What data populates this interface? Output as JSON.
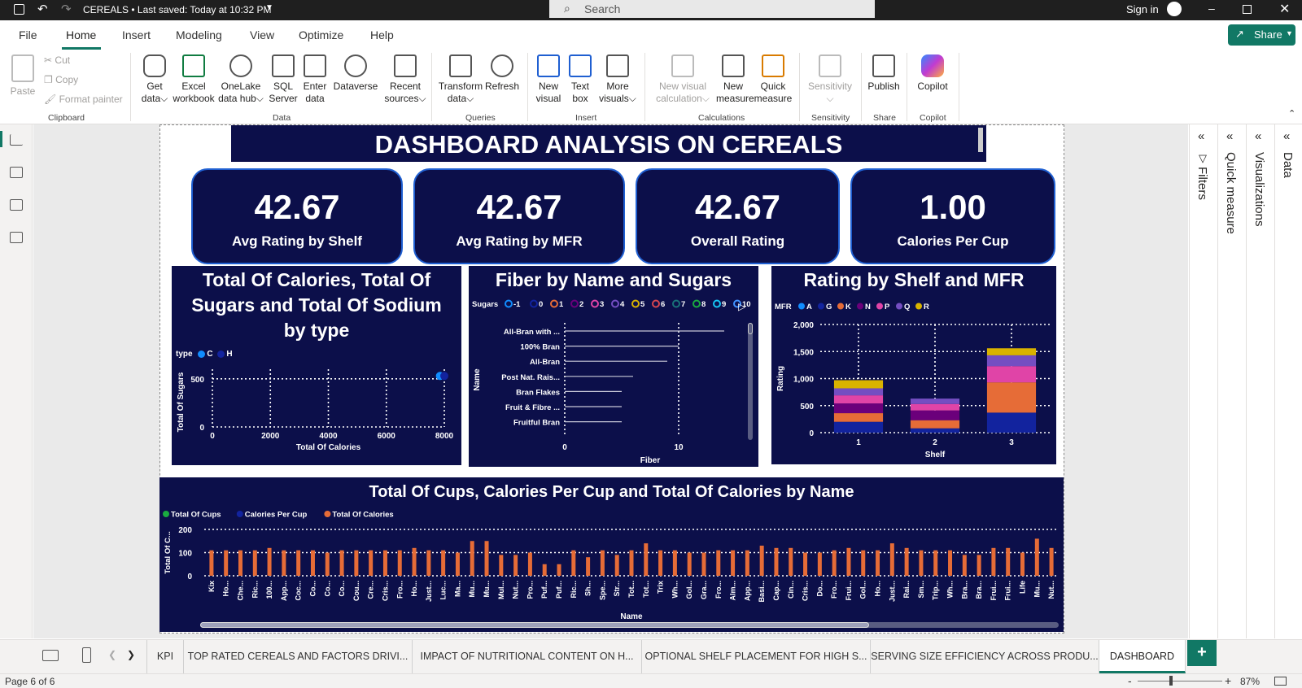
{
  "titlebar": {
    "file_title": "CEREALS",
    "saved_status": "Last saved: Today at 10:32 PM",
    "search_placeholder": "Search",
    "sign_in": "Sign in"
  },
  "menu": {
    "items": [
      "File",
      "Home",
      "Insert",
      "Modeling",
      "View",
      "Optimize",
      "Help"
    ],
    "active": "Home",
    "share": "Share"
  },
  "ribbon": {
    "clipboard": {
      "paste": "Paste",
      "cut": "Cut",
      "copy": "Copy",
      "format_painter": "Format painter",
      "group": "Clipboard"
    },
    "data": {
      "get_data": [
        "Get",
        "data"
      ],
      "excel": [
        "Excel",
        "workbook"
      ],
      "onelake": [
        "OneLake",
        "data hub"
      ],
      "sql": [
        "SQL",
        "Server"
      ],
      "enter": [
        "Enter",
        "data"
      ],
      "dataverse": "Dataverse",
      "recent": [
        "Recent",
        "sources"
      ],
      "group": "Data"
    },
    "queries": {
      "transform": [
        "Transform",
        "data"
      ],
      "refresh": "Refresh",
      "group": "Queries"
    },
    "insert": {
      "new_visual": [
        "New",
        "visual"
      ],
      "text_box": [
        "Text",
        "box"
      ],
      "more_visuals": [
        "More",
        "visuals"
      ],
      "group": "Insert"
    },
    "calculations": {
      "new_visual_calc": [
        "New visual",
        "calculation"
      ],
      "new_measure": [
        "New",
        "measure"
      ],
      "quick_measure": [
        "Quick",
        "measure"
      ],
      "group": "Calculations"
    },
    "sensitivity": {
      "label": "Sensitivity",
      "group": "Sensitivity"
    },
    "share": {
      "publish": "Publish",
      "group": "Share"
    },
    "copilot": {
      "label": "Copilot",
      "group": "Copilot"
    }
  },
  "dashboard": {
    "title": "DASHBOARD ANALYSIS ON CEREALS",
    "kpis": [
      {
        "value": "42.67",
        "label": "Avg Rating by Shelf"
      },
      {
        "value": "42.67",
        "label": "Avg Rating by MFR"
      },
      {
        "value": "42.67",
        "label": "Overall Rating"
      },
      {
        "value": "1.00",
        "label": "Calories Per Cup"
      }
    ]
  },
  "chart_data": [
    {
      "type": "scatter",
      "title": "Total Of Calories, Total Of Sugars and Total Of Sodium by type",
      "legend_title": "type",
      "legend": [
        {
          "name": "C",
          "color": "#118dff"
        },
        {
          "name": "H",
          "color": "#12239e"
        }
      ],
      "xlabel": "Total Of Calories",
      "ylabel": "Total Of Sugars",
      "xlim": [
        0,
        8000
      ],
      "ylim": [
        0,
        600
      ],
      "xticks": [
        "0",
        "2000",
        "4000",
        "6000",
        "8000"
      ],
      "yticks": [
        "0",
        "500"
      ],
      "points": [
        {
          "series": "C",
          "x": 7850,
          "y": 530
        },
        {
          "series": "H",
          "x": 8000,
          "y": 530
        }
      ]
    },
    {
      "type": "bar",
      "orientation": "horizontal",
      "title": "Fiber by Name and Sugars",
      "legend_title": "Sugars",
      "legend": [
        "-1",
        "0",
        "1",
        "2",
        "3",
        "4",
        "5",
        "6",
        "7",
        "8",
        "9",
        "10"
      ],
      "legend_colors": [
        "#118dff",
        "#12239e",
        "#e66c37",
        "#6b007b",
        "#e044a7",
        "#744ec2",
        "#d9b300",
        "#d64550",
        "#197278",
        "#1aab40",
        "#15c6f4",
        "#4092ff"
      ],
      "categories": [
        "All-Bran with ...",
        "100% Bran",
        "All-Bran",
        "Post Nat. Rais...",
        "Bran Flakes",
        "Fruit & Fibre ...",
        "Fruitful Bran"
      ],
      "values": [
        14,
        10,
        9,
        6,
        5,
        5,
        5
      ],
      "xlabel": "Fiber",
      "ylabel": "Name",
      "xlim": [
        0,
        15
      ],
      "xticks": [
        "0",
        "10"
      ]
    },
    {
      "type": "bar",
      "stacked": true,
      "title": "Rating by Shelf and MFR",
      "legend_title": "MFR",
      "categories": [
        "1",
        "2",
        "3"
      ],
      "series": [
        {
          "name": "A",
          "color": "#118dff",
          "values": [
            0,
            0,
            0
          ]
        },
        {
          "name": "G",
          "color": "#12239e",
          "values": [
            200,
            80,
            370
          ]
        },
        {
          "name": "K",
          "color": "#e66c37",
          "values": [
            160,
            150,
            560
          ]
        },
        {
          "name": "N",
          "color": "#6b007b",
          "values": [
            180,
            180,
            0
          ]
        },
        {
          "name": "P",
          "color": "#e044a7",
          "values": [
            150,
            120,
            300
          ]
        },
        {
          "name": "Q",
          "color": "#744ec2",
          "values": [
            130,
            100,
            200
          ]
        },
        {
          "name": "R",
          "color": "#d9b300",
          "values": [
            150,
            0,
            130
          ]
        }
      ],
      "xlabel": "Shelf",
      "ylabel": "Rating",
      "ylim": [
        0,
        2000
      ],
      "yticks": [
        "0",
        "500",
        "1,000",
        "1,500",
        "2,000"
      ]
    },
    {
      "type": "bar",
      "title": "Total Of Cups, Calories Per Cup and Total Of Calories by Name",
      "legend": [
        {
          "name": "Total Of Cups",
          "color": "#1aab40"
        },
        {
          "name": "Calories Per Cup",
          "color": "#12239e"
        },
        {
          "name": "Total Of Calories",
          "color": "#e66c37"
        }
      ],
      "xlabel": "Name",
      "ylabel": "Total Of C...",
      "ylim": [
        0,
        200
      ],
      "yticks": [
        "0",
        "100",
        "200"
      ],
      "categories": [
        "Kix",
        "Ho...",
        "Che...",
        "Ric...",
        "100...",
        "App...",
        "Coc...",
        "Co...",
        "Co...",
        "Co...",
        "Cou...",
        "Cre...",
        "Cris...",
        "Fro...",
        "Ho...",
        "Just...",
        "Luc...",
        "Ma...",
        "Mu...",
        "Mu...",
        "Mul...",
        "Nut...",
        "Pro...",
        "Puf...",
        "Puf...",
        "Ric...",
        "Sh...",
        "Spe...",
        "Str...",
        "Tot...",
        "Tot...",
        "Trix",
        "Wh...",
        "Gol...",
        "Gra...",
        "Fro...",
        "Alm...",
        "App...",
        "Basi...",
        "Cap...",
        "Cin...",
        "Cris...",
        "Do...",
        "Fro...",
        "Frui...",
        "Gol...",
        "Ho...",
        "Just...",
        "Rai...",
        "Sm...",
        "Trip...",
        "Wh...",
        "Bra...",
        "Bra...",
        "Frui...",
        "Frui...",
        "Life",
        "Mu...",
        "Nut..."
      ],
      "values": [
        110,
        110,
        110,
        110,
        120,
        110,
        110,
        110,
        100,
        110,
        110,
        110,
        110,
        110,
        120,
        110,
        110,
        100,
        150,
        150,
        90,
        90,
        100,
        50,
        50,
        110,
        80,
        110,
        90,
        110,
        140,
        110,
        110,
        100,
        100,
        110,
        110,
        110,
        130,
        120,
        120,
        100,
        100,
        110,
        120,
        110,
        110,
        140,
        120,
        110,
        110,
        110,
        90,
        90,
        120,
        120,
        100,
        160,
        120
      ]
    }
  ],
  "right_panes": {
    "filters": "Filters",
    "quick_measure": "Quick measure",
    "visualizations": "Visualizations",
    "data": "Data"
  },
  "tabs": [
    "KPI",
    "TOP RATED CEREALS AND FACTORS DRIVI...",
    "IMPACT OF NUTRITIONAL CONTENT ON H...",
    "OPTIONAL SHELF PLACEMENT FOR HIGH S...",
    "SERVING SIZE EFFICIENCY ACROSS PRODU...",
    "DASHBOARD"
  ],
  "active_tab": "DASHBOARD",
  "add_tab": "+",
  "status": {
    "page": "Page 6 of 6",
    "zoom": "87%",
    "minus": "-",
    "plus": "+"
  }
}
